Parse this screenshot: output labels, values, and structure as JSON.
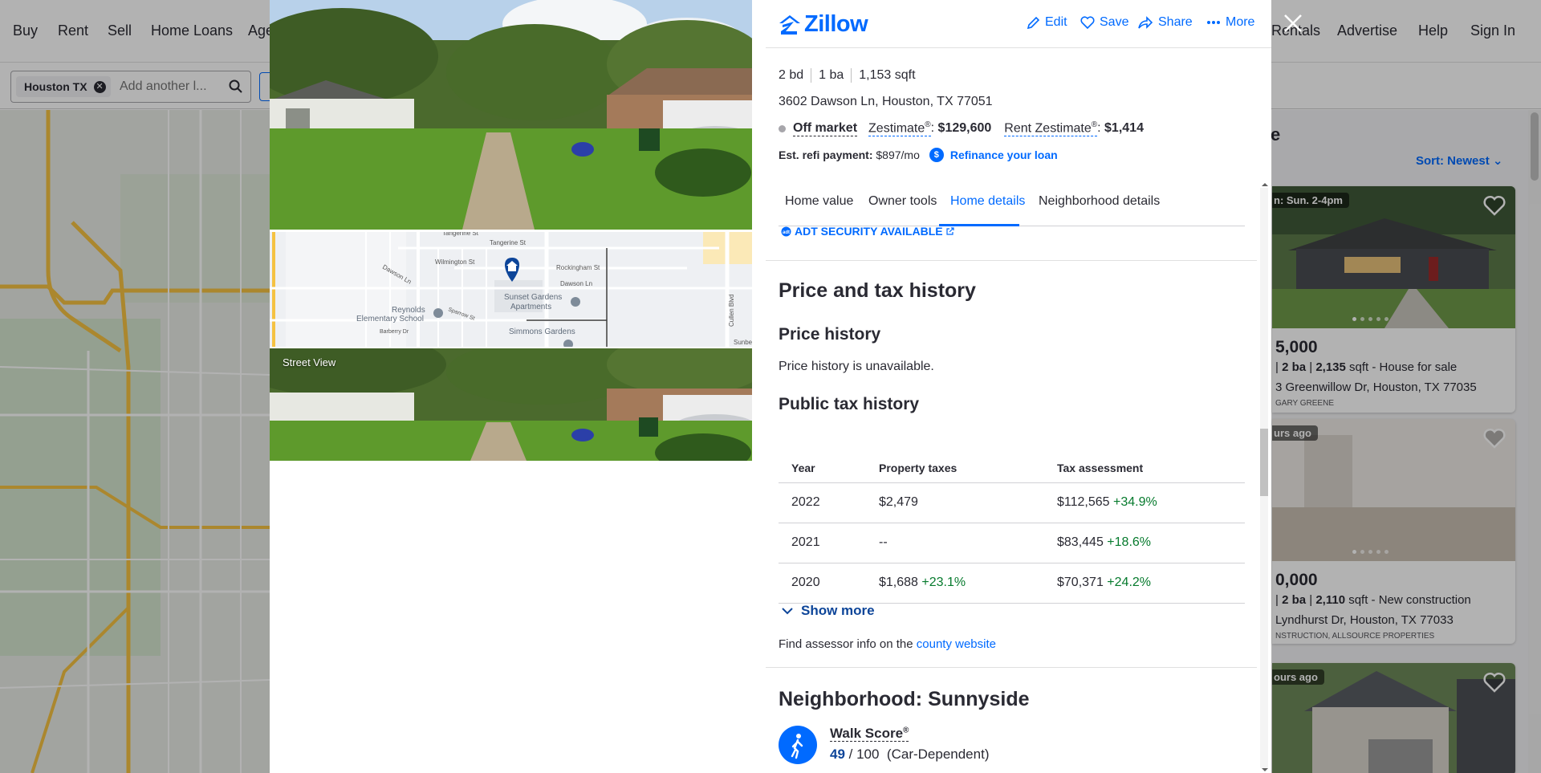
{
  "nav": {
    "buy": "Buy",
    "rent": "Rent",
    "sell": "Sell",
    "home_loans": "Home Loans",
    "agent_partial": "Age",
    "rentals_partial": "Rentals",
    "advertise": "Advertise",
    "help": "Help",
    "sign_in": "Sign In"
  },
  "search": {
    "chip": "Houston TX",
    "placeholder": "Add another l..."
  },
  "results": {
    "heading_partial": "e",
    "sort": "Sort: Newest",
    "cards": [
      {
        "tag": "n: Sun. 2-4pm",
        "price": "5,000",
        "meta_prefix": "| ",
        "beds": "2 ba",
        "sqft": "2,135",
        "meta_suffix": " sqft - House for sale",
        "address": "3 Greenwillow Dr, Houston, TX 77035",
        "broker": "GARY GREENE"
      },
      {
        "tag": "urs ago",
        "price": "0,000",
        "meta_prefix": "| ",
        "beds": "2 ba",
        "sqft": "2,110",
        "meta_suffix": " sqft - New construction",
        "address": "Lyndhurst Dr, Houston, TX 77033",
        "broker": "NSTRUCTION, ALLSOURCE PROPERTIES"
      },
      {
        "tag": "ours ago"
      }
    ]
  },
  "photos": {
    "street_view_label": "Street View"
  },
  "map_labels": {
    "tangerine": "Tangerine St",
    "wilmington": "Wilmington St",
    "rockingham": "Rockingham St",
    "dawson": "Dawson Ln",
    "dawson2": "Dawson Ln",
    "sunset": "Sunset Gardens",
    "sunset2": "Apartments",
    "reynolds": "Reynolds",
    "reynolds2": "Elementary School",
    "simmons": "Simmons Gardens",
    "barberry": "Barberry Dr",
    "cullen": "Cullen Blvd",
    "sunbe": "Sunbe",
    "sparrow": "Sparrow St"
  },
  "header": {
    "logo": "Zillow",
    "edit": "Edit",
    "save": "Save",
    "share": "Share",
    "more": "More"
  },
  "property": {
    "beds": "2 bd",
    "baths": "1 ba",
    "sqft": "1,153 sqft",
    "address": "3602 Dawson Ln, Houston, TX 77051",
    "status": "Off market",
    "zestimate_label": "Zestimate",
    "zestimate_value": "$129,600",
    "rent_label": "Rent Zestimate",
    "rent_value": "$1,414",
    "reg": "®",
    "refi_label": "Est. refi payment:",
    "refi_value": "$897/mo",
    "refi_icon": "$",
    "refi_link": "Refinance your loan"
  },
  "tabs": {
    "home_value": "Home value",
    "owner_tools": "Owner tools",
    "home_details": "Home details",
    "neighborhood": "Neighborhood details"
  },
  "adt": "ADT SECURITY AVAILABLE",
  "price_tax": {
    "title": "Price and tax history",
    "price_history_title": "Price history",
    "price_history_text": "Price history is unavailable.",
    "tax_title": "Public tax history",
    "headers": {
      "year": "Year",
      "taxes": "Property taxes",
      "assessment": "Tax assessment"
    },
    "rows": [
      {
        "year": "2022",
        "tax": "$2,479",
        "tax_change": "",
        "assessment": "$112,565",
        "assessment_change": "+34.9%"
      },
      {
        "year": "2021",
        "tax": "--",
        "tax_change": "",
        "assessment": "$83,445",
        "assessment_change": "+18.6%"
      },
      {
        "year": "2020",
        "tax": "$1,688",
        "tax_change": "+23.1%",
        "assessment": "$70,371",
        "assessment_change": "+24.2%"
      }
    ],
    "show_more": "Show more",
    "assessor_prefix": "Find assessor info on the ",
    "assessor_link": "county website"
  },
  "neighborhood": {
    "title": "Neighborhood: Sunnyside",
    "walk_label": "Walk Score",
    "walk_value": "49",
    "walk_max": " / 100",
    "walk_desc": "(Car-Dependent)"
  },
  "colors": {
    "accent": "#006aff",
    "positive": "#067a2d",
    "text": "#2a2a33"
  }
}
